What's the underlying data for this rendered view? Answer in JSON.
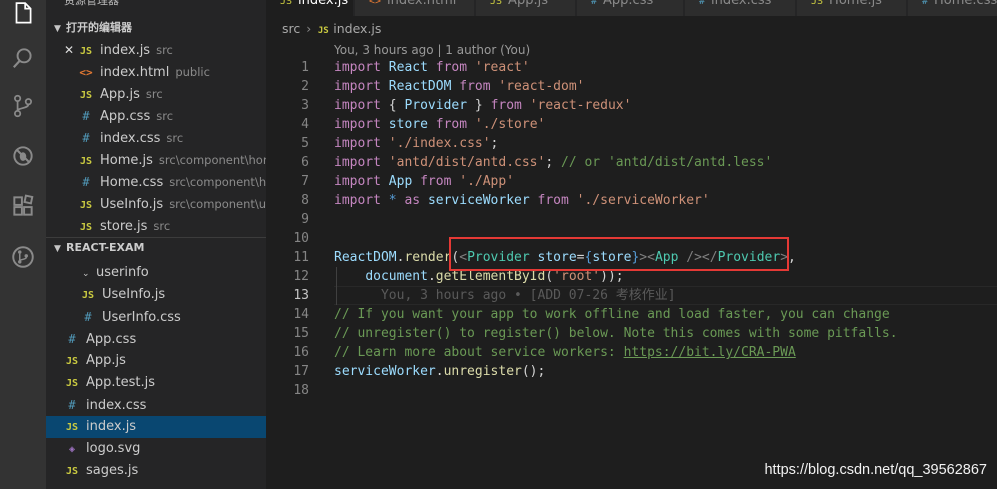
{
  "activity_bar": {
    "icons": [
      "files-icon",
      "search-icon",
      "source-control-icon",
      "debug-icon",
      "extensions-icon",
      "remote-icon"
    ]
  },
  "sidebar": {
    "title": "资源管理器",
    "open_editors": {
      "label": "打开的编辑器",
      "items": [
        {
          "type": "js",
          "name": "index.js",
          "desc": "src"
        },
        {
          "type": "html",
          "name": "index.html",
          "desc": "public"
        },
        {
          "type": "js",
          "name": "App.js",
          "desc": "src"
        },
        {
          "type": "css",
          "name": "App.css",
          "desc": "src"
        },
        {
          "type": "css",
          "name": "index.css",
          "desc": "src"
        },
        {
          "type": "js",
          "name": "Home.js",
          "desc": "src\\component\\home"
        },
        {
          "type": "css",
          "name": "Home.css",
          "desc": "src\\component\\h..."
        },
        {
          "type": "js",
          "name": "UseInfo.js",
          "desc": "src\\component\\us..."
        },
        {
          "type": "js",
          "name": "store.js",
          "desc": "src"
        }
      ]
    },
    "project": {
      "label": "REACT-EXAM",
      "folder": "userinfo",
      "items": [
        {
          "type": "js",
          "name": "UseInfo.js"
        },
        {
          "type": "css",
          "name": "UserInfo.css"
        },
        {
          "type": "css",
          "name": "App.css"
        },
        {
          "type": "js",
          "name": "App.js"
        },
        {
          "type": "js",
          "name": "App.test.js"
        },
        {
          "type": "css",
          "name": "index.css"
        },
        {
          "type": "js",
          "name": "index.js"
        },
        {
          "type": "svg",
          "name": "logo.svg"
        },
        {
          "type": "js",
          "name": "sages.js"
        }
      ]
    }
  },
  "tabs": [
    {
      "icon": "JS",
      "label": "index.js"
    },
    {
      "icon": "<>",
      "label": "index.html"
    },
    {
      "icon": "JS",
      "label": "App.js"
    },
    {
      "icon": "#",
      "label": "App.css"
    },
    {
      "icon": "#",
      "label": "index.css"
    },
    {
      "icon": "JS",
      "label": "Home.js"
    },
    {
      "icon": "#",
      "label": "Home.css"
    }
  ],
  "breadcrumb": {
    "folder": "src",
    "sep": "›",
    "icon": "JS",
    "file": "index.js"
  },
  "editor": {
    "codelens": "You, 3 hours ago | 1 author (You)",
    "line_numbers": [
      "1",
      "2",
      "3",
      "4",
      "5",
      "6",
      "7",
      "8",
      "9",
      "10",
      "11",
      "12",
      "13",
      "14",
      "15",
      "16",
      "17",
      "18"
    ],
    "tokens": {
      "import": "import",
      "from": "from",
      "as": "as",
      "React": "React",
      "ReactDOM": "ReactDOM",
      "Provider": "Provider",
      "store": "store",
      "App": "App",
      "serviceWorker": "serviceWorker",
      "star": "*",
      "lbrace": "{ ",
      "rbrace": " }",
      "s_react": "'react'",
      "s_react_dom": "'react-dom'",
      "s_react_redux": "'react-redux'",
      "s_store": "'./store'",
      "s_index_css": "'./index.css'",
      "s_antd_css": "'antd/dist/antd.css'",
      "c_antd_less": "// or 'antd/dist/antd.less'",
      "s_app": "'./App'",
      "s_service_worker": "'./serviceWorker'",
      "semi": ";",
      "dot": ".",
      "render": "render",
      "lparen": "(",
      "rparen": ")",
      "comma": ",",
      "tag_open": "<",
      "tag_close": ">",
      "tag_selfclose": " />",
      "tag_end_open": "</",
      "attr_store": "store",
      "eq": "=",
      "jsx_lbrace": "{",
      "jsx_rbrace": "}",
      "document": "document",
      "getElementById": "getElementById",
      "s_root": "'root'",
      "blame": "You, 3 hours ago • [ADD 07-26 考核作业]",
      "c14": "// If you want your app to work offline and load faster, you can change",
      "c15": "// unregister() to register() below. Note this comes with some pitfalls.",
      "c16_prefix": "// Learn more about service workers: ",
      "c16_link": "https://bit.ly/CRA-PWA",
      "unregister": "unregister",
      "call_end": "();"
    }
  },
  "watermark": "https://blog.csdn.net/qq_39562867",
  "colors": {
    "highlight_box": "#e53935",
    "selected_row": "#094771",
    "keyword": "#569cd6",
    "string": "#ce9178",
    "comment": "#6a9955",
    "jsx_tag": "#4ec9b0"
  }
}
